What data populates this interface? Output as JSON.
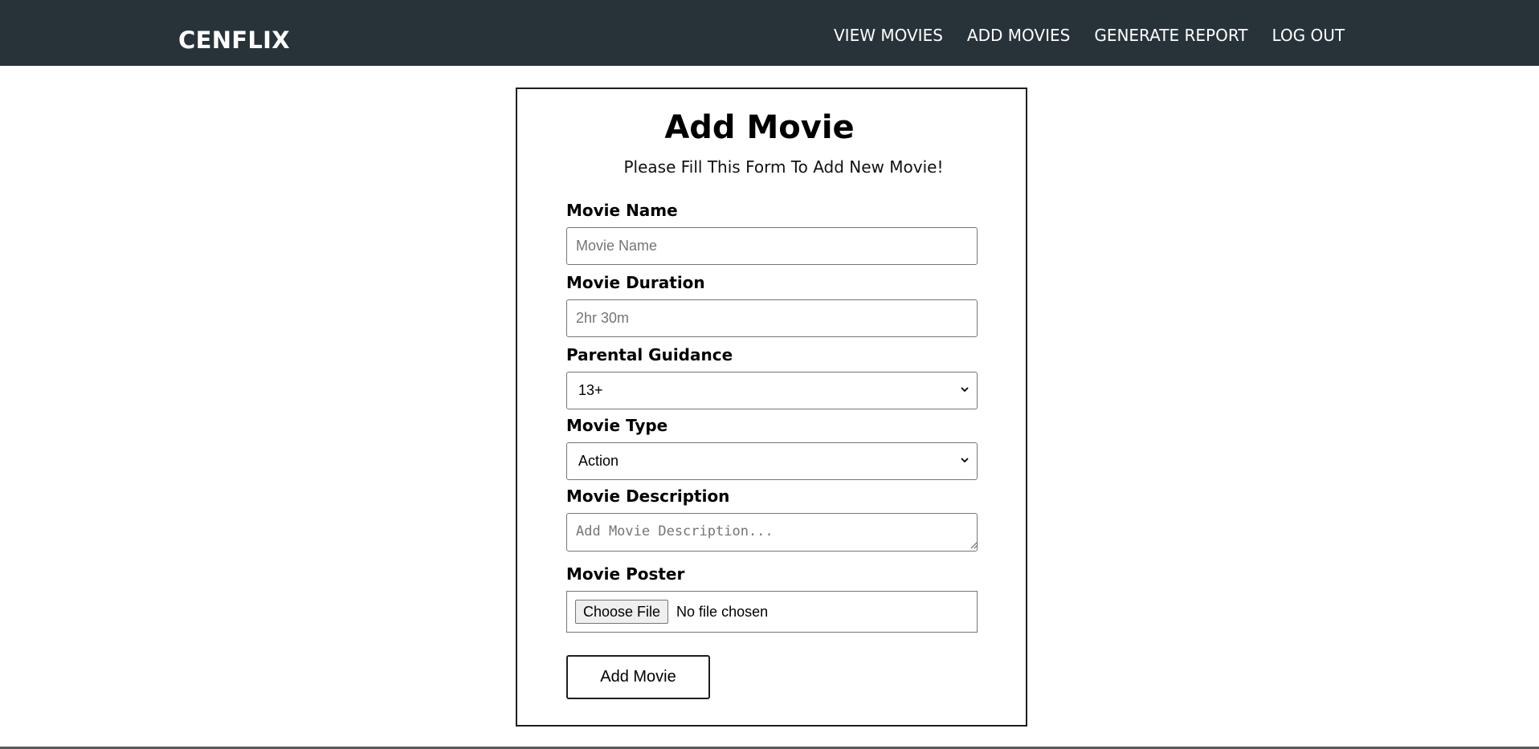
{
  "navbar": {
    "brand": "CENFLIX",
    "links": [
      {
        "label": "VIEW MOVIES"
      },
      {
        "label": "ADD MOVIES"
      },
      {
        "label": "GENERATE REPORT"
      },
      {
        "label": "LOG OUT"
      }
    ],
    "background_color": "#283339"
  },
  "form": {
    "title": "Add Movie",
    "subtitle": "Please Fill This Form To Add New Movie!",
    "fields": {
      "movie_name": {
        "label": "Movie Name",
        "placeholder": "Movie Name",
        "value": ""
      },
      "movie_duration": {
        "label": "Movie Duration",
        "placeholder": "2hr 30m",
        "value": ""
      },
      "parental_guidance": {
        "label": "Parental Guidance",
        "selected": "13+"
      },
      "movie_type": {
        "label": "Movie Type",
        "selected": "Action"
      },
      "movie_description": {
        "label": "Movie Description",
        "placeholder": "Add Movie Description...",
        "value": ""
      },
      "movie_poster": {
        "label": "Movie Poster",
        "button_label": "Choose File",
        "status": "No file chosen"
      }
    },
    "submit_label": "Add Movie"
  },
  "icons": {
    "select_arrow": "chevron-down-icon",
    "textarea_resize": "resize-grip-icon"
  }
}
